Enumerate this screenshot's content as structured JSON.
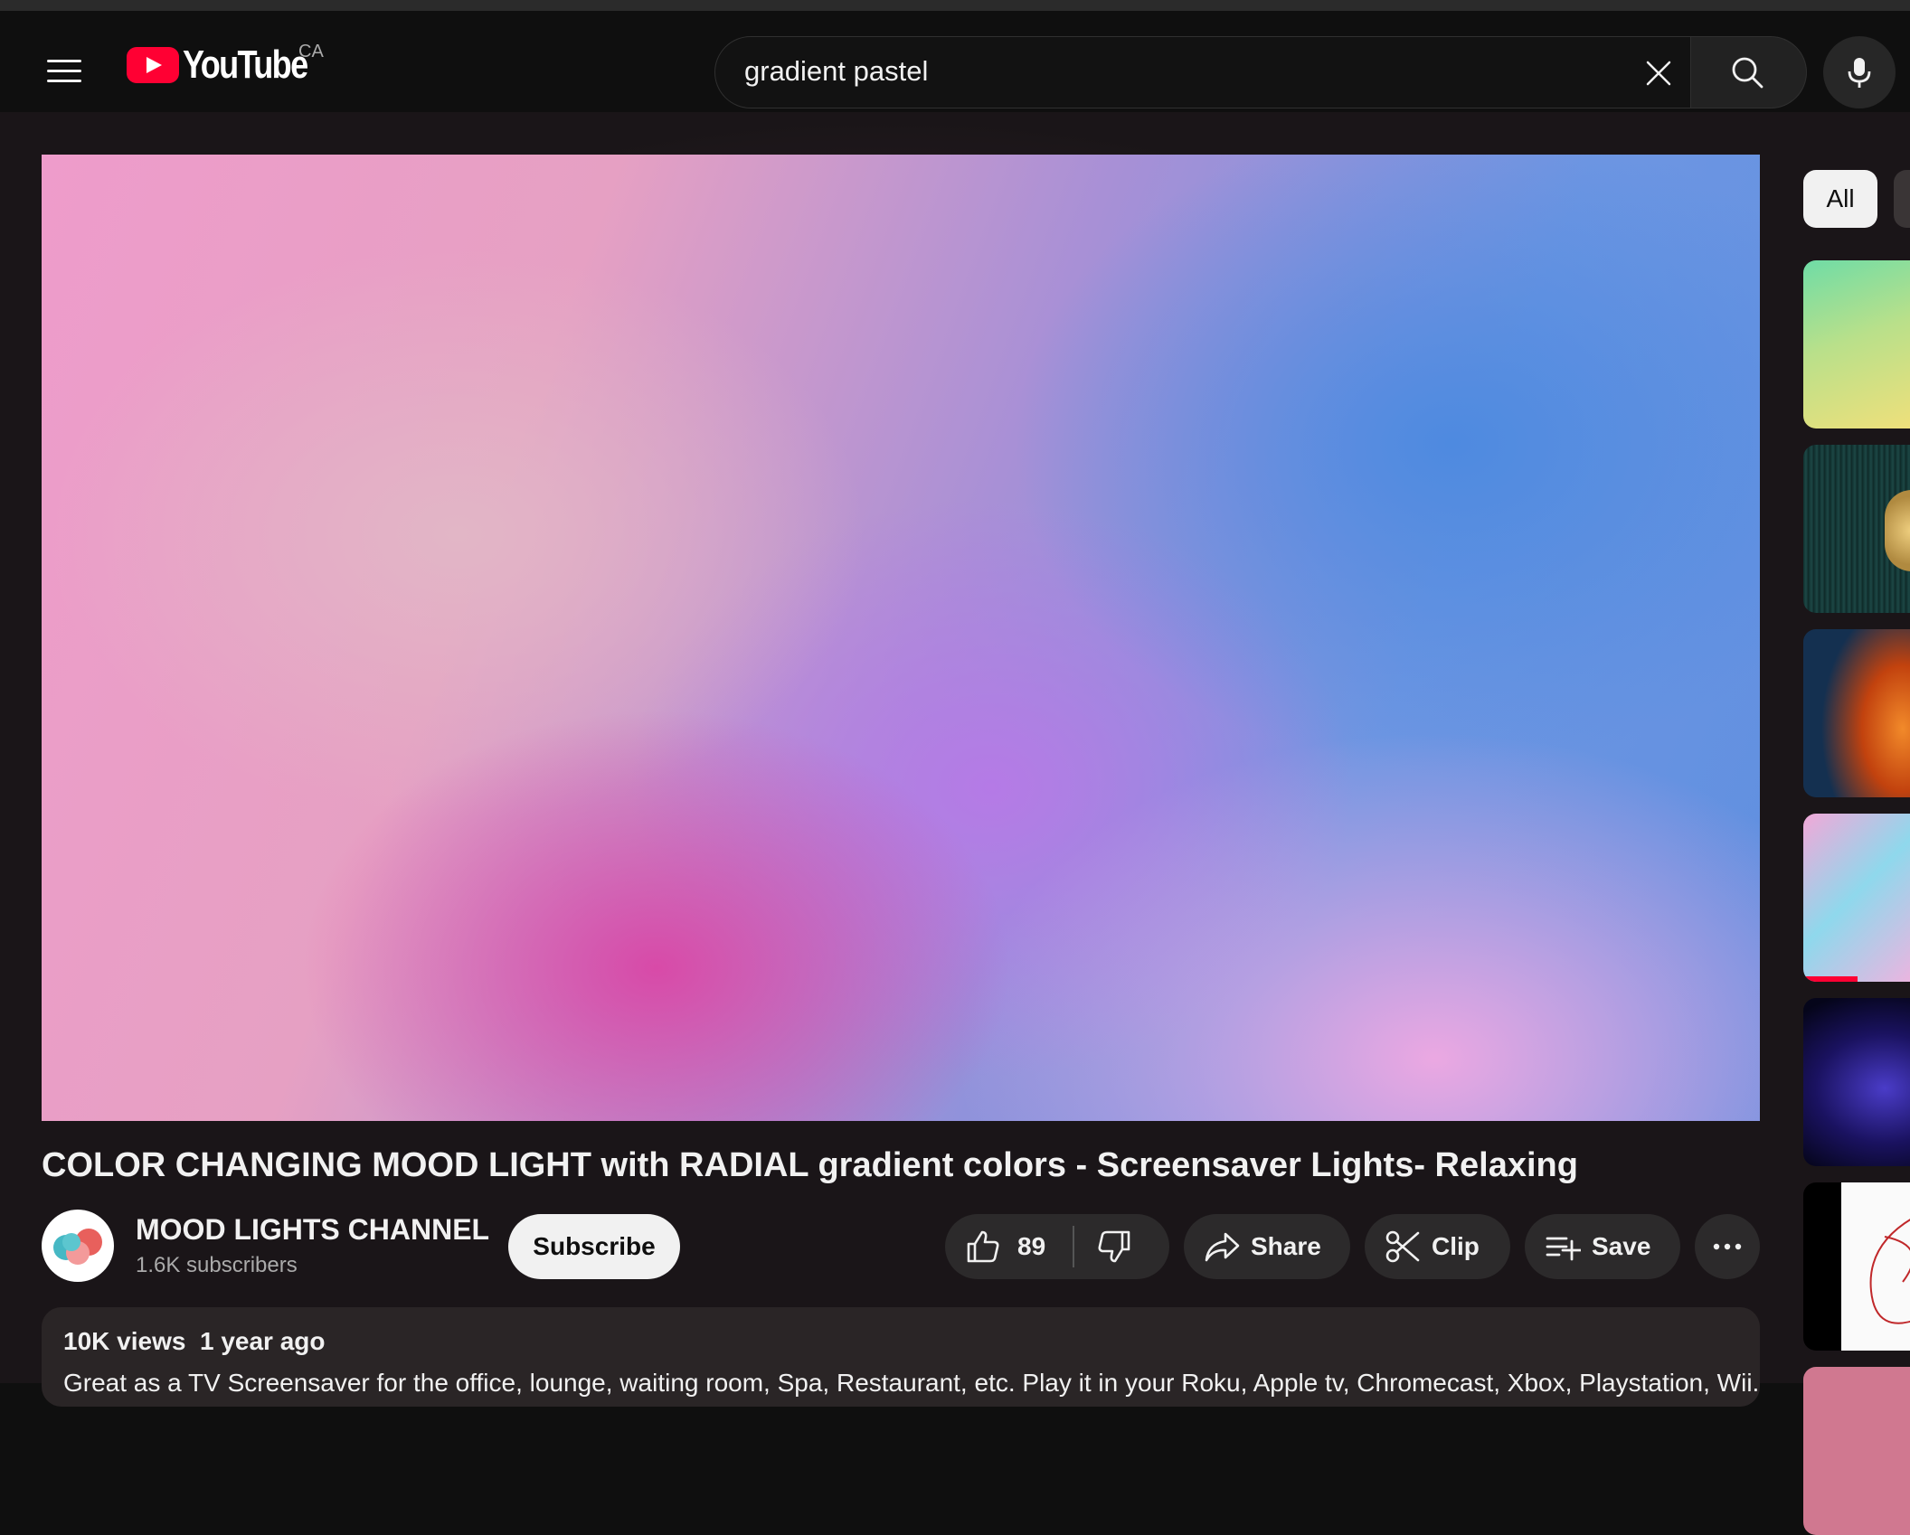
{
  "header": {
    "logo_text": "YouTube",
    "country_code": "CA",
    "search_query": "gradient pastel"
  },
  "video": {
    "title": "COLOR CHANGING MOOD LIGHT with RADIAL gradient colors - Screensaver Lights- Relaxing",
    "channel_name": "MOOD LIGHTS CHANNEL",
    "subscribers": "1.6K subscribers",
    "subscribe_label": "Subscribe",
    "like_count": "89",
    "share_label": "Share",
    "clip_label": "Clip",
    "save_label": "Save"
  },
  "description": {
    "views": "10K views",
    "age": "1 year ago",
    "text": "Great as a TV Screensaver for the office, lounge, waiting room, Spa, Restaurant, etc. Play it in your Roku, Apple tv, Chromecast, Xbox, Playstation, Wii..."
  },
  "sidebar": {
    "chips": [
      "All"
    ]
  },
  "colors": {
    "background": "#0f0f0f",
    "brand_red": "#ff0033",
    "pill_bg": "#2c2a2b"
  }
}
